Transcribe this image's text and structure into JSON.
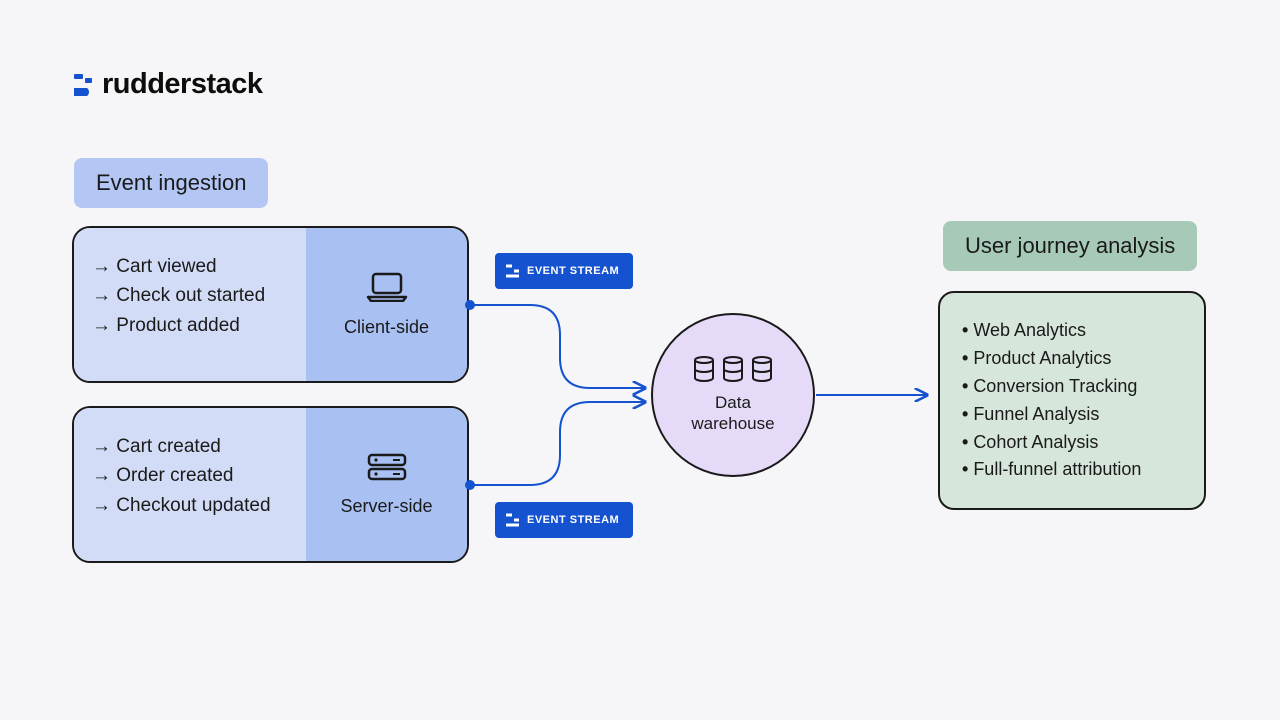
{
  "brand": {
    "name": "rudderstack"
  },
  "sections": {
    "ingestion_title": "Event ingestion",
    "analysis_title": "User journey analysis"
  },
  "ingestion": {
    "client": {
      "label": "Client-side",
      "events": [
        "Cart viewed",
        "Check out started",
        "Product added"
      ]
    },
    "server": {
      "label": "Server-side",
      "events": [
        "Cart created",
        "Order created",
        "Checkout updated"
      ]
    }
  },
  "stream_label": "EVENT STREAM",
  "warehouse": {
    "label_line1": "Data",
    "label_line2": "warehouse"
  },
  "analysis": {
    "items": [
      "Web Analytics",
      "Product Analytics",
      "Conversion Tracking",
      "Funnel Analysis",
      "Cohort Analysis",
      "Full-funnel attribution"
    ]
  }
}
